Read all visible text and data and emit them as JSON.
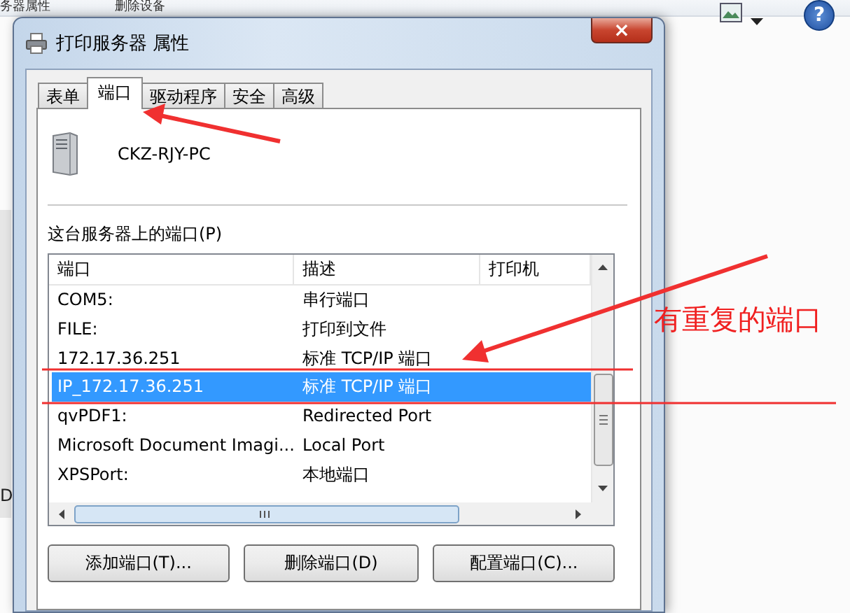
{
  "background": {
    "menu_items": [
      "务器属性",
      "删除设备"
    ],
    "help": "?",
    "edge_text": "D"
  },
  "dialog": {
    "title": "打印服务器 属性",
    "close": "×",
    "tabs": [
      {
        "label": "表单",
        "selected": false
      },
      {
        "label": "端口",
        "selected": true
      },
      {
        "label": "驱动程序",
        "selected": false
      },
      {
        "label": "安全",
        "selected": false
      },
      {
        "label": "高级",
        "selected": false
      }
    ],
    "server_name": "CKZ-RJY-PC",
    "ports_label": "这台服务器上的端口(P)",
    "table": {
      "columns": [
        "端口",
        "描述",
        "打印机"
      ],
      "rows": [
        {
          "port": "COM5:",
          "description": "串行端口",
          "selected": false
        },
        {
          "port": "FILE:",
          "description": "打印到文件",
          "selected": false
        },
        {
          "port": "172.17.36.251",
          "description": "标准 TCP/IP 端口",
          "selected": false
        },
        {
          "port": "IP_172.17.36.251",
          "description": "标准 TCP/IP 端口",
          "selected": true
        },
        {
          "port": "qvPDF1:",
          "description": "Redirected Port",
          "selected": false
        },
        {
          "port": "Microsoft Document Imagi...",
          "description": "Local Port",
          "selected": false
        },
        {
          "port": "XPSPort:",
          "description": "本地端口",
          "selected": false
        }
      ]
    },
    "buttons": [
      "添加端口(T)...",
      "删除端口(D)",
      "配置端口(C)..."
    ]
  },
  "annotation": {
    "text": "有重复的端口"
  }
}
